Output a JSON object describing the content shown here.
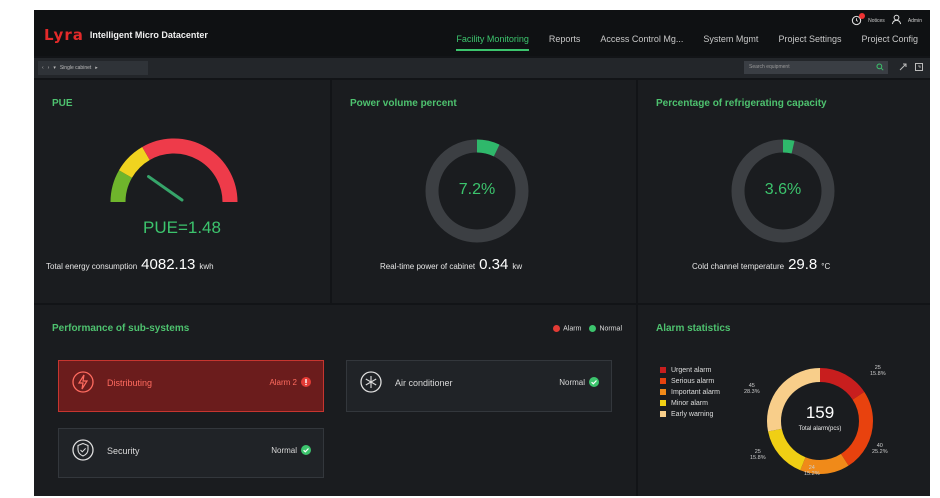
{
  "header": {
    "logo_mark": "Lyra",
    "app_title": "Intelligent Micro Datacenter",
    "nav": [
      "Facility Monitoring",
      "Reports",
      "Access Control Mg...",
      "System Mgmt",
      "Project Settings",
      "Project Config"
    ],
    "user": {
      "notify_label": "Notices",
      "user_label": "Admin"
    }
  },
  "toolbar": {
    "breadcrumb": "Single cabinet",
    "search_placeholder": "Search equipment"
  },
  "pue_panel": {
    "title": "PUE",
    "pue_text": "PUE=1.48",
    "pue_value": 1.48,
    "energy_label": "Total energy consumption",
    "energy_value": "4082.13",
    "energy_unit": "kwh"
  },
  "power_panel": {
    "title": "Power volume percent",
    "percent_text": "7.2%",
    "percent": 7.2,
    "realtime_label": "Real-time power of cabinet",
    "realtime_value": "0.34",
    "realtime_unit": "kw"
  },
  "cooling_panel": {
    "title": "Percentage of refrigerating capacity",
    "percent_text": "3.6%",
    "percent": 3.6,
    "cold_label": "Cold channel temperature",
    "cold_value": "29.8",
    "cold_unit": "°C"
  },
  "subsystems": {
    "title": "Performance of sub-systems",
    "legend_alarm": "Alarm",
    "legend_normal": "Normal",
    "items": [
      {
        "name": "Distributing",
        "status": "Alarm 2",
        "icon": "bolt-icon"
      },
      {
        "name": "Air conditioner",
        "status": "Normal",
        "icon": "snowflake-icon"
      },
      {
        "name": "Security",
        "status": "Normal",
        "icon": "shield-icon"
      }
    ]
  },
  "alarm_stats": {
    "title": "Alarm statistics",
    "total": "159",
    "total_label": "Total alarm(pcs)",
    "legend": [
      {
        "label": "Urgent alarm",
        "color": "#c81e1e"
      },
      {
        "label": "Serious alarm",
        "color": "#e8420e"
      },
      {
        "label": "Important alarm",
        "color": "#f08a19"
      },
      {
        "label": "Minor alarm",
        "color": "#f0cf14"
      },
      {
        "label": "Early warning",
        "color": "#f8ce8a"
      }
    ],
    "callouts": [
      {
        "count": "25",
        "pct": "15.8%"
      },
      {
        "count": "40",
        "pct": "25.2%"
      },
      {
        "count": "24",
        "pct": "15.2%"
      },
      {
        "count": "25",
        "pct": "15.8%"
      },
      {
        "count": "45",
        "pct": "28.3%"
      }
    ]
  },
  "colors": {
    "accent": "#3cc46d",
    "alarm": "#e33b35",
    "ring_track": "#3c3f43"
  }
}
